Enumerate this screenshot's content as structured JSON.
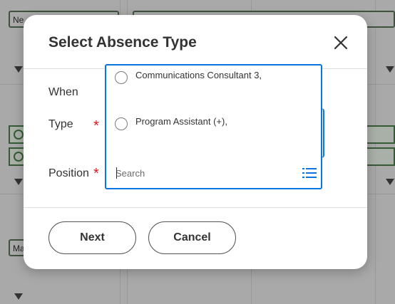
{
  "background": {
    "chip_top_text": "Ne",
    "chip_bottom_text": "Ma"
  },
  "modal": {
    "title": "Select Absence Type",
    "close_icon": "close-icon",
    "fields": {
      "when_label": "When",
      "type_label": "Type",
      "position_label": "Position",
      "required_marker": "*"
    },
    "dropdown": {
      "options": [
        {
          "label": "Communications Consultant 3,",
          "selected": false
        },
        {
          "label": "Program Assistant (+),",
          "selected": false
        }
      ],
      "search_placeholder": "Search",
      "list_icon": "list-icon"
    },
    "buttons": {
      "next_label": "Next",
      "cancel_label": "Cancel"
    }
  },
  "colors": {
    "accent": "#0875e1",
    "required": "#d7171f",
    "overlay": "#a9a9a9"
  }
}
